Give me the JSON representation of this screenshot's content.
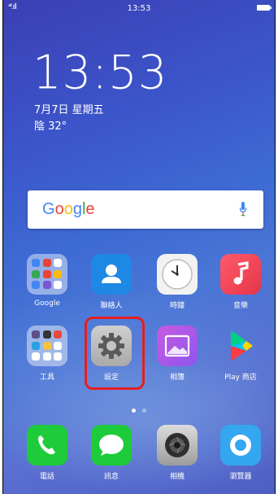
{
  "status_bar": {
    "signal": "ᵃⁱˡ.ıll",
    "time": "13:53"
  },
  "lockclock": {
    "time": "13:53",
    "date": "7月7日 星期五",
    "weather": "陰 32°"
  },
  "search": {
    "logo": "Google",
    "colors": [
      "#4285F4",
      "#EA4335",
      "#FBBC05",
      "#4285F4",
      "#34A853",
      "#EA4335"
    ]
  },
  "apps_row1": [
    {
      "label": "Google",
      "icon": "google-folder-icon"
    },
    {
      "label": "聯絡人",
      "icon": "contacts-icon"
    },
    {
      "label": "時鐘",
      "icon": "clock-icon"
    },
    {
      "label": "音樂",
      "icon": "music-icon"
    }
  ],
  "apps_row2": [
    {
      "label": "工具",
      "icon": "tools-folder-icon"
    },
    {
      "label": "設定",
      "icon": "settings-gear-icon"
    },
    {
      "label": "相簿",
      "icon": "gallery-icon"
    },
    {
      "label": "Play 商店",
      "icon": "play-store-icon"
    }
  ],
  "dock": [
    {
      "label": "電話",
      "icon": "phone-icon"
    },
    {
      "label": "訊息",
      "icon": "message-icon"
    },
    {
      "label": "相機",
      "icon": "camera-icon"
    },
    {
      "label": "瀏覽器",
      "icon": "browser-icon"
    }
  ],
  "page_indicator": {
    "active": 0,
    "count": 2
  },
  "highlight_color": "#E41F1F"
}
